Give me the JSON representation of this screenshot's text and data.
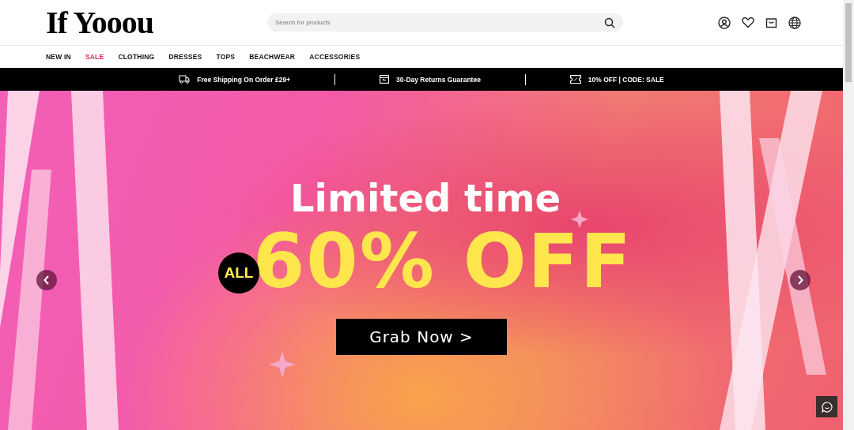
{
  "header": {
    "logo": "If Yooou",
    "search": {
      "placeholder": "Search for products"
    }
  },
  "nav": [
    {
      "label": "NEW IN",
      "kind": "normal"
    },
    {
      "label": "SALE",
      "kind": "sale"
    },
    {
      "label": "CLOTHING",
      "kind": "normal"
    },
    {
      "label": "DRESSES",
      "kind": "normal"
    },
    {
      "label": "TOPS",
      "kind": "normal"
    },
    {
      "label": "BEACHWEAR",
      "kind": "normal"
    },
    {
      "label": "ACCESSORIES",
      "kind": "normal"
    }
  ],
  "perks": [
    {
      "kind": "truck",
      "text": "Free Shipping On Order £29+"
    },
    {
      "kind": "returns",
      "text": "30-Day Returns Guarantee"
    },
    {
      "kind": "coupon",
      "text": "10% OFF | CODE: SALE"
    }
  ],
  "hero": {
    "headline": "Limited time",
    "tag": "ALL",
    "offer": "60% OFF",
    "cta": "Grab Now >"
  }
}
